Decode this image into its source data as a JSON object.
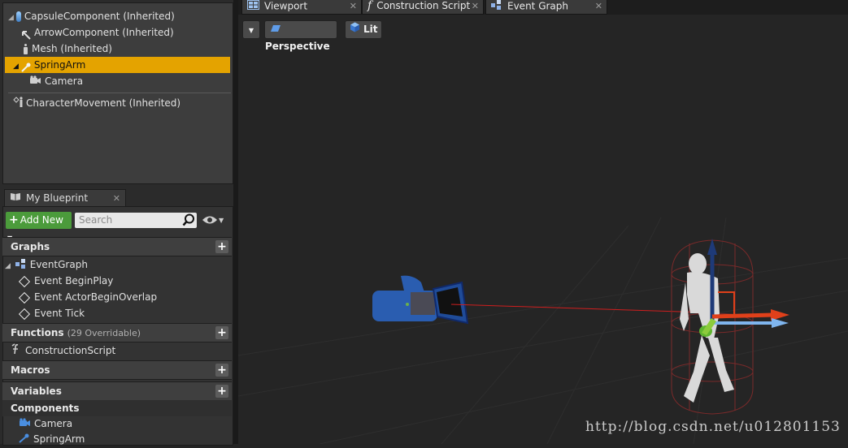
{
  "components": {
    "items": [
      {
        "label": "CapsuleComponent (Inherited)",
        "icon": "capsule-icon"
      },
      {
        "label": "ArrowComponent (Inherited)",
        "icon": "arrow-icon"
      },
      {
        "label": "Mesh (Inherited)",
        "icon": "mesh-icon"
      },
      {
        "label": "SpringArm",
        "icon": "spring-arm-icon",
        "selected": true
      },
      {
        "label": "Camera",
        "icon": "camera-icon"
      },
      {
        "label": "CharacterMovement (Inherited)",
        "icon": "character-movement-icon"
      }
    ]
  },
  "my_blueprint": {
    "tab_label": "My Blueprint",
    "close": "✕",
    "add_new_label": "Add New",
    "search_placeholder": "Search",
    "graphs": {
      "label": "Graphs",
      "event_graph": "EventGraph",
      "events": [
        "Event BeginPlay",
        "Event ActorBeginOverlap",
        "Event Tick"
      ]
    },
    "functions": {
      "label": "Functions",
      "sub": "(29 Overridable)",
      "items": [
        "ConstructionScript"
      ]
    },
    "macros": {
      "label": "Macros"
    },
    "variables": {
      "label": "Variables",
      "components_label": "Components",
      "items": [
        "Camera",
        "SpringArm"
      ]
    }
  },
  "editor_tabs": [
    {
      "label": "Viewport",
      "icon": "viewport-icon"
    },
    {
      "label": "Construction Script",
      "icon": "function-icon"
    },
    {
      "label": "Event Graph",
      "icon": "event-graph-icon"
    }
  ],
  "viewport": {
    "perspective_label": "Perspective",
    "lit_label": "Lit"
  },
  "watermark": "http://blog.csdn.net/u012801153",
  "colors": {
    "selection": "#e4a300",
    "add_new": "#4b9b3b",
    "camera_blue": "#2a5db0",
    "gizmo_x": "#e0401a",
    "gizmo_y": "#7fb5ee",
    "gizmo_z": "#1e3a78"
  }
}
